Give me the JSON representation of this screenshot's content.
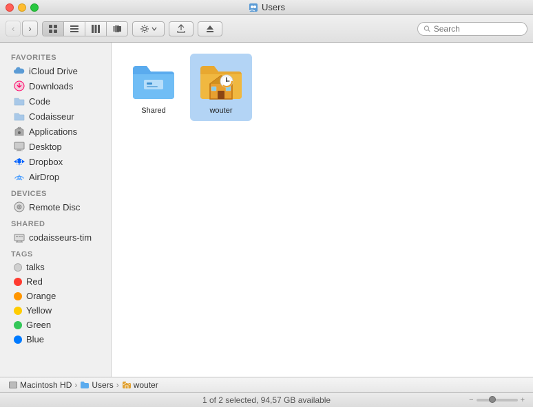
{
  "window": {
    "title": "Users",
    "title_icon": "👥"
  },
  "toolbar": {
    "back_label": "‹",
    "forward_label": "›",
    "view_icon_label": "⊞",
    "view_list_label": "≡",
    "view_col_label": "⊟",
    "view_cov_label": "⊡",
    "action_label": "⚙",
    "share_label": "⬆",
    "eject_label": "⏏",
    "search_placeholder": "Search"
  },
  "sidebar": {
    "favorites_label": "Favorites",
    "items": [
      {
        "id": "icloud-drive",
        "label": "iCloud Drive",
        "icon": "cloud"
      },
      {
        "id": "downloads",
        "label": "Downloads",
        "icon": "download"
      },
      {
        "id": "code",
        "label": "Code",
        "icon": "folder"
      },
      {
        "id": "codaisseur",
        "label": "Codaisseur",
        "icon": "folder"
      },
      {
        "id": "applications",
        "label": "Applications",
        "icon": "rocket"
      },
      {
        "id": "desktop",
        "label": "Desktop",
        "icon": "desktop"
      },
      {
        "id": "dropbox",
        "label": "Dropbox",
        "icon": "dropbox"
      },
      {
        "id": "airdrop",
        "label": "AirDrop",
        "icon": "airdrop"
      }
    ],
    "devices_label": "Devices",
    "devices": [
      {
        "id": "remote-disc",
        "label": "Remote Disc",
        "icon": "disc"
      }
    ],
    "shared_label": "Shared",
    "shared": [
      {
        "id": "codaisseurs-tim",
        "label": "codaisseurs-tim",
        "icon": "network"
      }
    ],
    "tags_label": "Tags",
    "tags": [
      {
        "id": "talks",
        "label": "talks",
        "color": "gray"
      },
      {
        "id": "red",
        "label": "Red",
        "color": "red"
      },
      {
        "id": "orange",
        "label": "Orange",
        "color": "orange"
      },
      {
        "id": "yellow",
        "label": "Yellow",
        "color": "yellow"
      },
      {
        "id": "green",
        "label": "Green",
        "color": "green"
      },
      {
        "id": "blue",
        "label": "Blue",
        "color": "blue"
      }
    ]
  },
  "content": {
    "items": [
      {
        "id": "shared-folder",
        "label": "Shared",
        "type": "folder-blue",
        "selected": false
      },
      {
        "id": "wouter-folder",
        "label": "wouter",
        "type": "home",
        "selected": true
      }
    ]
  },
  "status_bar": {
    "breadcrumb": [
      {
        "id": "macintosh-hd",
        "label": "Macintosh HD",
        "icon": "hd"
      },
      {
        "id": "users-crumb",
        "label": "Users",
        "icon": "folder-blue"
      },
      {
        "id": "wouter-crumb",
        "label": "wouter",
        "icon": "home"
      }
    ],
    "info": "1 of 2 selected, 94,57 GB available",
    "slider_value": 50
  }
}
